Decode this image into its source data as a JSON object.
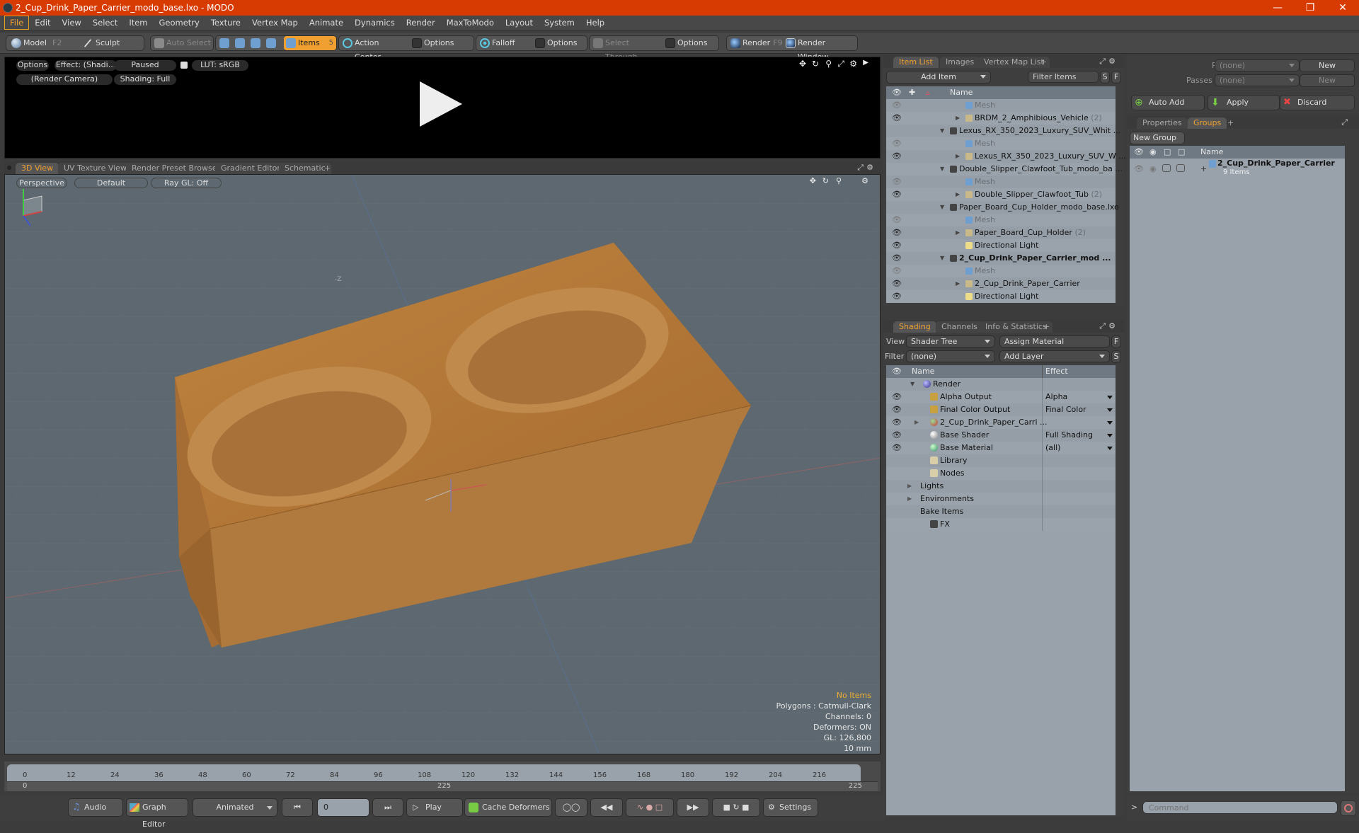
{
  "window": {
    "title": "2_Cup_Drink_Paper_Carrier_modo_base.lxo - MODO",
    "controls": [
      "minimize",
      "restore",
      "close"
    ]
  },
  "menubar": [
    "File",
    "Edit",
    "View",
    "Select",
    "Item",
    "Geometry",
    "Texture",
    "Vertex Map",
    "Animate",
    "Dynamics",
    "Render",
    "MaxToModo",
    "Layout",
    "System",
    "Help"
  ],
  "toolbar": {
    "model": "Model",
    "model_key": "F2",
    "sculpt": "Sculpt",
    "auto_select": "Auto Select",
    "items": "Items",
    "items_count": "5",
    "action_center": "Action Center",
    "options1": "Options",
    "falloff": "Falloff",
    "options2": "Options",
    "select_through": "Select Through",
    "options3": "Options",
    "render": "Render",
    "render_key": "F9",
    "render_window": "Render Window"
  },
  "render_preview": {
    "options": "Options",
    "effect": "Effect: (Shadi...",
    "status": "Paused",
    "lut": "LUT: sRGB",
    "camera": "(Render Camera)",
    "shading": "Shading: Full"
  },
  "viewport_tabs": [
    "3D View",
    "UV Texture View",
    "Render Preset Browser",
    "Gradient Editor",
    "Schematic",
    "+"
  ],
  "viewport": {
    "projection": "Perspective",
    "style": "Default",
    "raygl": "Ray GL: Off",
    "axis_label": "-Z",
    "stats": {
      "selection": "No Items",
      "polygons": "Polygons : Catmull-Clark",
      "channels": "Channels: 0",
      "deformers": "Deformers: ON",
      "gl": "GL: 126,800",
      "scale": "10 mm"
    },
    "colors": {
      "accent": "#f0a030",
      "model": "#b0773a",
      "background": "#5d6870"
    }
  },
  "timeline": {
    "ticks": [
      "0",
      "12",
      "24",
      "36",
      "48",
      "60",
      "72",
      "84",
      "96",
      "108",
      "120",
      "132",
      "144",
      "156",
      "168",
      "180",
      "192",
      "204",
      "216"
    ],
    "range_start": "0",
    "range_mid": "225",
    "range_end": "225"
  },
  "transport": {
    "audio": "Audio",
    "graph_editor": "Graph Editor",
    "mode": "Animated",
    "frame": "0",
    "play": "Play",
    "cache_deformers": "Cache Deformers",
    "settings": "Settings"
  },
  "item_list": {
    "tabs": [
      "Item List",
      "Images",
      "Vertex Map List",
      "+"
    ],
    "add_item": "Add Item",
    "filter_placeholder": "Filter Items",
    "s": "S",
    "f": "F",
    "col_name": "Name",
    "rows": [
      {
        "indent": 2,
        "label": "Mesh",
        "type": "mesh",
        "dim": true,
        "eye": true
      },
      {
        "indent": 2,
        "label": "BRDM_2_Amphibious_Vehicle",
        "count": "(2)",
        "type": "folder",
        "eye": true
      },
      {
        "indent": 1,
        "label": "Lexus_RX_350_2023_Luxury_SUV_Whit ...",
        "type": "scene",
        "eye": false
      },
      {
        "indent": 2,
        "label": "Mesh",
        "type": "mesh",
        "dim": true,
        "eye": true
      },
      {
        "indent": 2,
        "label": "Lexus_RX_350_2023_Luxury_SUV_W ...",
        "type": "folder",
        "eye": true
      },
      {
        "indent": 1,
        "label": "Double_Slipper_Clawfoot_Tub_modo_ba ...",
        "type": "scene",
        "eye": false
      },
      {
        "indent": 2,
        "label": "Mesh",
        "type": "mesh",
        "dim": true,
        "eye": true
      },
      {
        "indent": 2,
        "label": "Double_Slipper_Clawfoot_Tub",
        "count": "(2)",
        "type": "folder",
        "eye": true
      },
      {
        "indent": 1,
        "label": "Paper_Board_Cup_Holder_modo_base.lxo",
        "type": "scene",
        "eye": false
      },
      {
        "indent": 2,
        "label": "Mesh",
        "type": "mesh",
        "dim": true,
        "eye": true
      },
      {
        "indent": 2,
        "label": "Paper_Board_Cup_Holder",
        "count": "(2)",
        "type": "folder",
        "eye": true
      },
      {
        "indent": 2,
        "label": "Directional Light",
        "type": "light",
        "eye": true
      },
      {
        "indent": 1,
        "label": "2_Cup_Drink_Paper_Carrier_mod ...",
        "type": "scene",
        "bold": true,
        "eye": true
      },
      {
        "indent": 2,
        "label": "Mesh",
        "type": "mesh",
        "dim": true,
        "eye": true
      },
      {
        "indent": 2,
        "label": "2_Cup_Drink_Paper_Carrier",
        "type": "folder",
        "eye": true
      },
      {
        "indent": 2,
        "label": "Directional Light",
        "type": "light",
        "eye": true
      }
    ]
  },
  "shading": {
    "tabs": [
      "Shading",
      "Channels",
      "Info & Statistics",
      "+"
    ],
    "view_label": "View",
    "view_value": "Shader Tree",
    "assign_material": "Assign Material",
    "f": "F",
    "filter_label": "Filter",
    "filter_value": "(none)",
    "add_layer": "Add Layer",
    "s": "S",
    "col_name": "Name",
    "col_effect": "Effect",
    "rows": [
      {
        "label": "Render",
        "effect": "",
        "type": "render",
        "eye": false,
        "level": 0
      },
      {
        "label": "Alpha Output",
        "effect": "Alpha",
        "type": "output",
        "eye": true,
        "level": 1
      },
      {
        "label": "Final Color Output",
        "effect": "Final Color",
        "type": "output",
        "eye": true,
        "level": 1
      },
      {
        "label": "2_Cup_Drink_Paper_Carri ...",
        "effect": "",
        "type": "material-group",
        "eye": true,
        "level": 1,
        "expand": true
      },
      {
        "label": "Base Shader",
        "effect": "Full Shading",
        "type": "shader",
        "eye": true,
        "level": 1
      },
      {
        "label": "Base Material",
        "effect": "(all)",
        "type": "material",
        "eye": true,
        "level": 1
      },
      {
        "label": "Library",
        "effect": "",
        "type": "folder",
        "eye": false,
        "level": 1
      },
      {
        "label": "Nodes",
        "effect": "",
        "type": "folder",
        "eye": false,
        "level": 1
      },
      {
        "label": "Lights",
        "effect": "",
        "type": "none",
        "eye": false,
        "level": 0,
        "expand": true
      },
      {
        "label": "Environments",
        "effect": "",
        "type": "none",
        "eye": false,
        "level": 0,
        "expand": true
      },
      {
        "label": "Bake Items",
        "effect": "",
        "type": "none",
        "eye": false,
        "level": 0
      },
      {
        "label": "FX",
        "effect": "",
        "type": "scene",
        "eye": false,
        "level": 1
      }
    ]
  },
  "passes": {
    "pass_groups_label": "Pass Groups",
    "pass_groups_value": "(none)",
    "new1": "New",
    "passes_label": "Passes",
    "passes_value": "(none)",
    "new2": "New",
    "auto_add": "Auto Add",
    "apply": "Apply",
    "discard": "Discard"
  },
  "groups": {
    "tabs": [
      "Properties",
      "Groups",
      "+"
    ],
    "new_group": "New Group",
    "col_name": "Name",
    "rows": [
      {
        "label": "2_Cup_Drink_Paper_Carrier",
        "sub": "9 Items"
      }
    ]
  },
  "command": {
    "placeholder": "Command",
    "prompt": ">"
  }
}
